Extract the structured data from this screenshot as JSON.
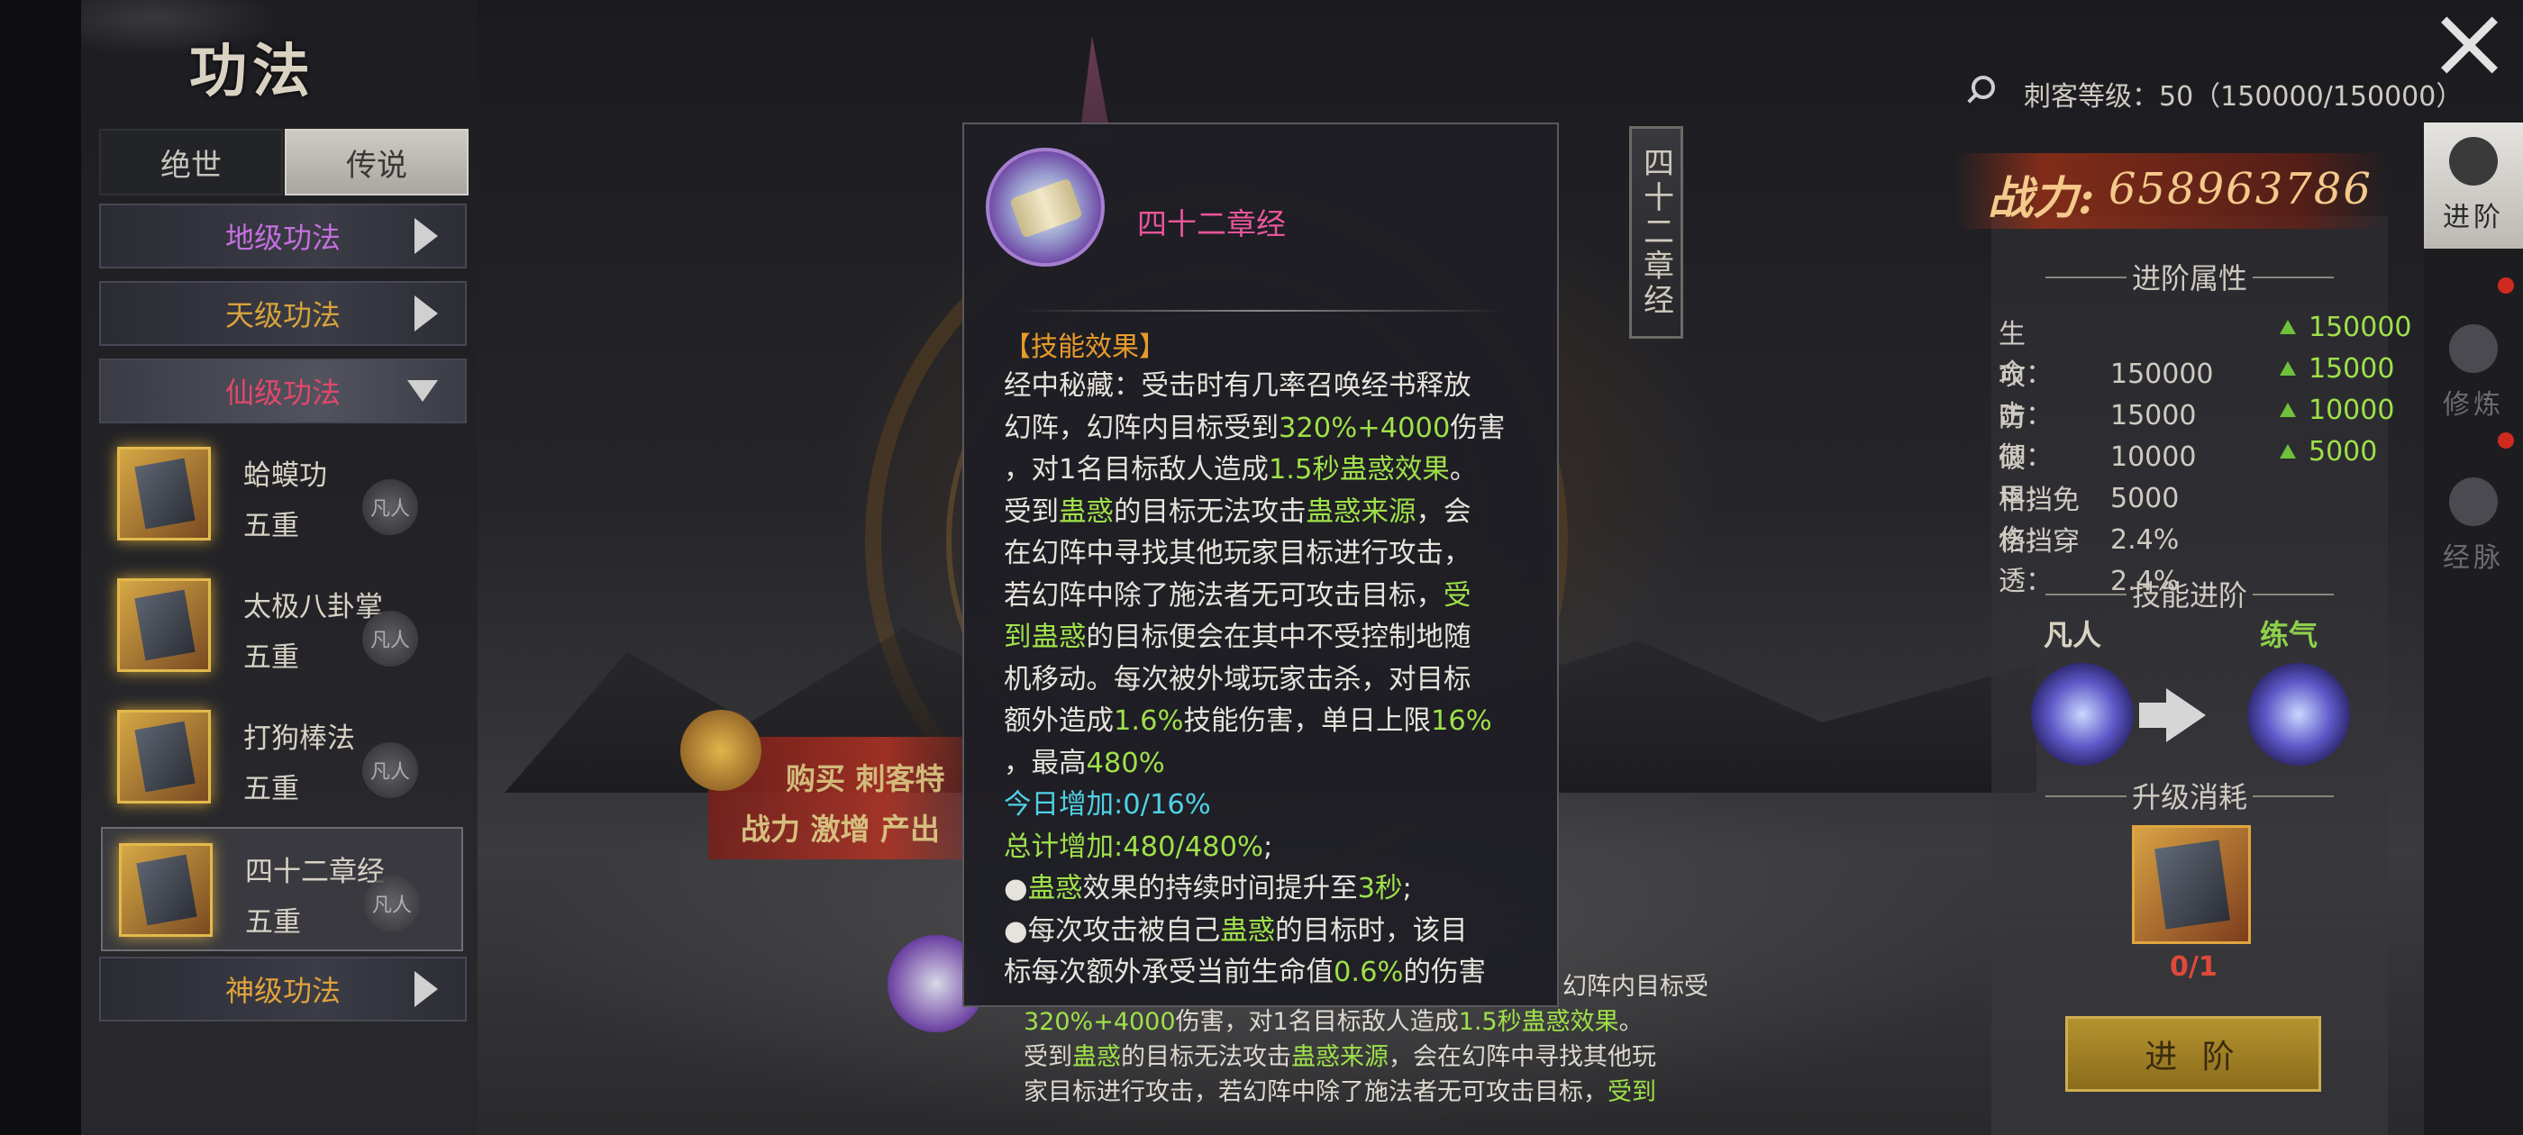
{
  "title": "功法",
  "tabs": [
    {
      "label": "绝世",
      "active": false
    },
    {
      "label": "传说",
      "active": true
    }
  ],
  "categories": [
    {
      "label": "地级功法",
      "color": "#c470e0",
      "expanded": false
    },
    {
      "label": "天级功法",
      "color": "#d8a43a",
      "expanded": false
    },
    {
      "label": "仙级功法",
      "color": "#e2486a",
      "expanded": true
    },
    {
      "label": "神级功法",
      "color": "#e0a33c",
      "expanded": false
    }
  ],
  "skills": [
    {
      "name": "蛤蟆功",
      "level": "五重",
      "stamp": "凡人",
      "selected": false
    },
    {
      "name": "太极八卦掌",
      "level": "五重",
      "stamp": "凡人",
      "selected": false
    },
    {
      "name": "打狗棒法",
      "level": "五重",
      "stamp": "凡人",
      "selected": false
    },
    {
      "name": "四十二章经",
      "level": "五重",
      "stamp": "凡人",
      "selected": true
    }
  ],
  "promo": {
    "line1": "购买 刺客特",
    "line2": "战力 激增 产出"
  },
  "plaque": "四十二章经",
  "tooltip": {
    "name": "四十二章经",
    "heading": "【技能效果】",
    "l1": "经中秘藏：受击时有几率召唤经书释放",
    "l2a": "幻阵，幻阵内目标受到",
    "l2b": "320%+4000",
    "l2c": "伤害",
    "l3a": "，对1名目标敌人造成",
    "l3b": "1.5秒蛊惑效果",
    "l3c": "。",
    "l4a": "受到",
    "l4b": "蛊惑",
    "l4c": "的目标无法攻击",
    "l4d": "蛊惑来源",
    "l4e": "，会",
    "l5": "在幻阵中寻找其他玩家目标进行攻击，",
    "l6a": "若幻阵中除了施法者无可攻击目标，",
    "l6b": "受",
    "l7a": "到蛊惑",
    "l7b": "的目标便会在其中不受控制地随",
    "l8": "机移动。每次被外域玩家击杀，对目标",
    "l9a": "额外造成",
    "l9b": "1.6%",
    "l9c": "技能伤害，单日上限",
    "l9d": "16%",
    "l10a": "，最高",
    "l10b": "480%",
    "l11": "今日增加:0/16%",
    "l12a": "总计增加:480/480%",
    "l12b": ";",
    "l13a": "●",
    "l13b": "蛊惑",
    "l13c": "效果的持续时间提升至",
    "l13d": "3秒",
    "l13e": ";",
    "l14a": "●每次攻击被自己",
    "l14b": "蛊惑",
    "l14c": "的目标时，该目",
    "l15a": "标每次额外承受当前生命值",
    "l15b": "0.6%",
    "l15c": "的伤害"
  },
  "under": {
    "u1": "幻阵内目标受",
    "u2a": "320%+4000",
    "u2b": "伤害，对1名目标敌人造成",
    "u2c": "1.5秒蛊惑效果",
    "u2d": "。",
    "u3a": "受到",
    "u3b": "蛊惑",
    "u3c": "的目标无法攻击",
    "u3d": "蛊惑来源",
    "u3e": "，会在幻阵中寻找其他玩",
    "u4a": "家目标进行攻击，若幻阵中除了施法者无可攻击目标，",
    "u4b": "受到"
  },
  "header": {
    "level_text": "刺客等级：50（150000/150000）",
    "power_label": "战力:",
    "power_value": "658963786"
  },
  "advance": {
    "attr_title": "进阶属性",
    "attributes": [
      {
        "label": "生　　命：",
        "value": "150000",
        "up": "150000"
      },
      {
        "label": "攻　　击：",
        "value": "15000",
        "up": "15000"
      },
      {
        "label": "防　　御：",
        "value": "10000",
        "up": "10000"
      },
      {
        "label": "破　　甲：",
        "value": "5000",
        "up": "5000"
      },
      {
        "label": "格挡免伤：",
        "value": "2.4%",
        "up": ""
      },
      {
        "label": "格挡穿透：",
        "value": "2.4%",
        "up": ""
      }
    ],
    "skill_title": "技能进阶",
    "from_rank": "凡人",
    "to_rank": "练气",
    "cost_title": "升级消耗",
    "cost_count": "0/1",
    "button": "进 阶"
  },
  "side_tabs": [
    {
      "label": "进阶",
      "active": true
    },
    {
      "label": "修炼",
      "active": false
    },
    {
      "label": "经脉",
      "active": false
    }
  ]
}
